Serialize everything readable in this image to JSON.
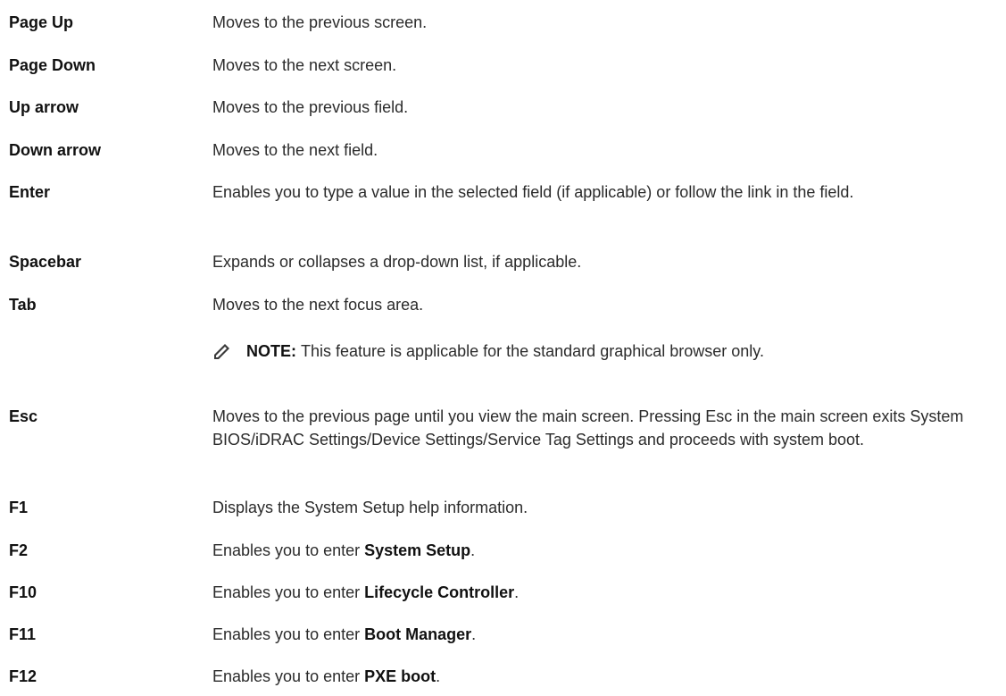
{
  "rows": [
    {
      "key": "Page Up",
      "desc": "Moves to the previous screen."
    },
    {
      "key": "Page Down",
      "desc": "Moves to the next screen."
    },
    {
      "key": "Up arrow",
      "desc": "Moves to the previous field."
    },
    {
      "key": "Down arrow",
      "desc": "Moves to the next field."
    },
    {
      "key": "Enter",
      "desc": "Enables you to type a value in the selected field (if applicable) or follow the link in the field."
    },
    {
      "key": "Spacebar",
      "desc": "Expands or collapses a drop-down list, if applicable."
    },
    {
      "key": "Tab",
      "desc": "Moves to the next focus area."
    },
    {
      "key": "Esc",
      "desc": "Moves to the previous page until you view the main screen. Pressing Esc in the main screen exits System BIOS/iDRAC Settings/Device Settings/Service Tag Settings and proceeds with system boot."
    },
    {
      "key": "F1",
      "desc": "Displays the System Setup help information."
    },
    {
      "key": "F2",
      "desc_prefix": "Enables you to enter ",
      "desc_bold": "System Setup",
      "desc_suffix": "."
    },
    {
      "key": "F10",
      "desc_prefix": "Enables you to enter ",
      "desc_bold": "Lifecycle Controller",
      "desc_suffix": "."
    },
    {
      "key": "F11",
      "desc_prefix": "Enables you to enter ",
      "desc_bold": "Boot Manager",
      "desc_suffix": "."
    },
    {
      "key": "F12",
      "desc_prefix": "Enables you to enter ",
      "desc_bold": "PXE boot",
      "desc_suffix": "."
    }
  ],
  "note": {
    "icon": "pencil-note-icon",
    "label": "NOTE:",
    "text": "This feature is applicable for the standard graphical browser only."
  }
}
